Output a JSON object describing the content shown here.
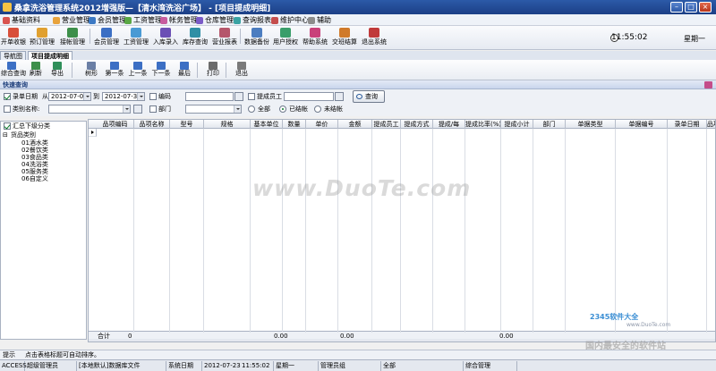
{
  "window": {
    "title": "桑拿洗浴管理系统2012增强版—【清水湾洗浴广场】 - [项目提成明细]",
    "buttons": [
      "–",
      "□",
      "×"
    ]
  },
  "menu": [
    {
      "label": "基础资料",
      "color": "#d9534f"
    },
    {
      "label": "营业管理",
      "color": "#e8a33d"
    },
    {
      "label": "会员管理",
      "color": "#3c79c4"
    },
    {
      "label": "工资管理",
      "color": "#5aa845"
    },
    {
      "label": "帐务管理",
      "color": "#c75b9e"
    },
    {
      "label": "仓库管理",
      "color": "#7a5bc7"
    },
    {
      "label": "查询报表",
      "color": "#3aa3a3"
    },
    {
      "label": "维护中心",
      "color": "#c44d4d"
    },
    {
      "label": "辅助",
      "color": "#8c8c8c"
    }
  ],
  "toolbar": [
    {
      "label": "开单收银",
      "icon": "cash-register-icon",
      "color": "#d84f3a"
    },
    {
      "label": "预订管理",
      "icon": "calendar-icon",
      "color": "#e0a030"
    },
    {
      "label": "接帐管理",
      "icon": "ledger-icon",
      "color": "#3d8f4a"
    },
    {
      "label": "会员管理",
      "icon": "members-icon",
      "color": "#3c6fc4"
    },
    {
      "label": "工资管理",
      "icon": "wage-icon",
      "color": "#4a9ad4"
    },
    {
      "label": "入库录入",
      "icon": "stock-in-icon",
      "color": "#6b4fb5"
    },
    {
      "label": "库存查询",
      "icon": "inventory-icon",
      "color": "#2f8fa5"
    },
    {
      "label": "营业报表",
      "icon": "report-icon",
      "color": "#b5566b"
    },
    {
      "label": "数据备份",
      "icon": "backup-icon",
      "color": "#4c7dc0"
    },
    {
      "label": "用户授权",
      "icon": "user-auth-icon",
      "color": "#3a9e6a"
    },
    {
      "label": "帮助系统",
      "icon": "help-icon",
      "color": "#c9407a"
    },
    {
      "label": "交班结算",
      "icon": "shift-icon",
      "color": "#d07a2a"
    },
    {
      "label": "退出系统",
      "icon": "exit-icon",
      "color": "#c03a3a"
    }
  ],
  "clock": {
    "time": "11:55:02",
    "weekday": "星期一"
  },
  "tabs": [
    "导航图",
    "项目提成明细"
  ],
  "toolbar2": [
    {
      "label": "综合查询",
      "icon": "query-icon",
      "color": "#3c6fc4"
    },
    {
      "label": "刷新",
      "icon": "refresh-icon",
      "color": "#3d8f4a"
    },
    {
      "label": "导出",
      "icon": "export-icon",
      "color": "#2f8f5a"
    },
    {
      "label": "树形",
      "icon": "tree-icon",
      "color": "#6b7fa5"
    },
    {
      "label": "第一条",
      "icon": "first-record-icon",
      "color": "#3c6fc4"
    },
    {
      "label": "上一条",
      "icon": "prev-record-icon",
      "color": "#3c6fc4"
    },
    {
      "label": "下一条",
      "icon": "next-record-icon",
      "color": "#3c6fc4"
    },
    {
      "label": "最后",
      "icon": "last-record-icon",
      "color": "#3c6fc4"
    },
    {
      "label": "打印",
      "icon": "print-icon",
      "color": "#6b6b6b"
    },
    {
      "label": "退出",
      "icon": "exit-icon",
      "color": "#7a7a7a"
    }
  ],
  "quick_query": {
    "title": "快速查询",
    "record_date_label": "录单日期",
    "from_label": "从",
    "date_from": "2012-07-01",
    "to_label": "到",
    "date_to": "2012-07-31",
    "code_label": "编码",
    "staff_label": "提成员工",
    "query_button": "查询",
    "category_label": "类别名称:",
    "dept_label": "部门",
    "radio_all": "全部",
    "radio_settled": "已结帐",
    "radio_unsettled": "未结帐"
  },
  "tree": {
    "summary_label": "汇总下级分类",
    "root": "货品类别",
    "items": [
      "01酒水类",
      "02餐饮类",
      "03食品类",
      "04洗浴类",
      "05服务类",
      "06自定义"
    ]
  },
  "grid": {
    "columns": [
      "品项编码",
      "品项名称",
      "型号",
      "规格",
      "基本单位",
      "数量",
      "单价",
      "金额",
      "提成员工",
      "提成方式",
      "提成/每",
      "提成比率(%)",
      "提成小计",
      "部门",
      "单据类型",
      "单据编号",
      "录单日期",
      "品项全"
    ],
    "total_label": "合计",
    "total_count": "0",
    "total_qty": "0.00",
    "total_amount": "0.00",
    "total_commission": "0.00"
  },
  "hint": {
    "label": "提示",
    "text": "点击表格标题可自动排序。"
  },
  "status": {
    "db": "ACCESS",
    "user": "超级管理员",
    "account": "[本地默认]数据库文件",
    "date_label": "系统日期",
    "date": "2012-07-23",
    "time": "11:55:02",
    "weekday": "星期一",
    "group": "管理员组",
    "scope": "全部",
    "module": "综合管理"
  },
  "watermark": {
    "main": "www.DuoTe.com",
    "logo": "2345软件大全",
    "url": "www.DuoTe.com",
    "slogan": "国内最安全的软件站"
  }
}
